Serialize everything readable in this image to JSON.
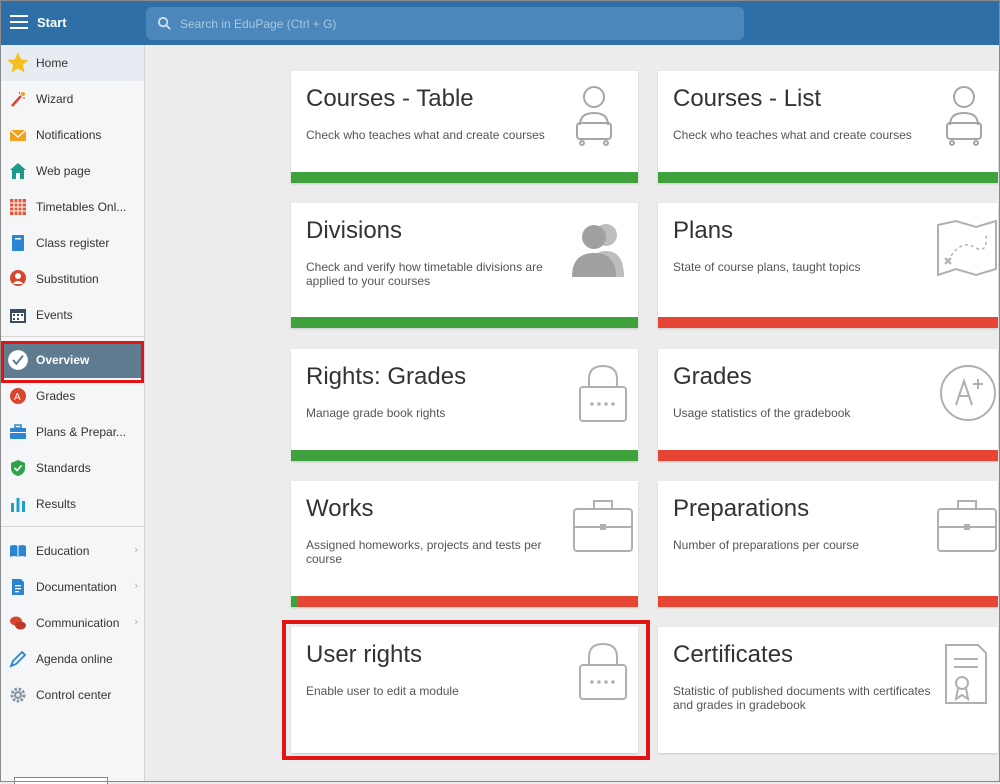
{
  "topbar": {
    "title": "Start",
    "search_placeholder": "Search in EduPage (Ctrl + G)"
  },
  "sidebar": {
    "items": [
      {
        "label": "Home",
        "icon": "star-icon"
      },
      {
        "label": "Wizard",
        "icon": "wand-icon"
      },
      {
        "label": "Notifications",
        "icon": "envelope-icon"
      },
      {
        "label": "Web page",
        "icon": "house-icon"
      },
      {
        "label": "Timetables Onl...",
        "icon": "timetable-grid-icon"
      },
      {
        "label": "Class register",
        "icon": "book-icon"
      },
      {
        "label": "Substitution",
        "icon": "substitute-person-icon"
      },
      {
        "label": "Events",
        "icon": "calendar-icon"
      },
      {
        "label": "Overview",
        "icon": "check-badge-icon"
      },
      {
        "label": "Grades",
        "icon": "grade-icon"
      },
      {
        "label": "Plans & Prepar...",
        "icon": "briefcase-icon"
      },
      {
        "label": "Standards",
        "icon": "shield-check-icon"
      },
      {
        "label": "Results",
        "icon": "bar-chart-icon"
      },
      {
        "label": "Education",
        "icon": "open-book-icon"
      },
      {
        "label": "Documentation",
        "icon": "document-icon"
      },
      {
        "label": "Communication",
        "icon": "chat-icon"
      },
      {
        "label": "Agenda online",
        "icon": "pen-icon"
      },
      {
        "label": "Control center",
        "icon": "gear-icon"
      }
    ]
  },
  "cards": [
    {
      "title": "Courses - Table",
      "desc": "Check who teaches what and create courses",
      "icon": "teacher-desk-icon",
      "status_green_fraction": 1.0
    },
    {
      "title": "Courses - List",
      "desc": "Check who teaches what and create courses",
      "icon": "teacher-desk-icon",
      "status_green_fraction": 1.0
    },
    {
      "title": "Divisions",
      "desc": "Check and verify how timetable divisions are applied to your courses",
      "icon": "people-icon",
      "status_green_fraction": 1.0
    },
    {
      "title": "Plans",
      "desc": "State of course plans, taught topics",
      "icon": "treasure-map-icon",
      "status_green_fraction": 0.0
    },
    {
      "title": "Rights: Grades",
      "desc": "Manage grade book rights",
      "icon": "padlock-icon",
      "status_green_fraction": 1.0
    },
    {
      "title": "Grades",
      "desc": "Usage statistics of the gradebook",
      "icon": "a-plus-grade-icon",
      "status_green_fraction": 0.0
    },
    {
      "title": "Works",
      "desc": "Assigned homeworks, projects and tests per course",
      "icon": "briefcase-icon",
      "status_green_fraction": 0.02
    },
    {
      "title": "Preparations",
      "desc": "Number of preparations per course",
      "icon": "briefcase-icon",
      "status_green_fraction": 0.0
    },
    {
      "title": "User rights",
      "desc": "Enable user to edit a module",
      "icon": "padlock-icon",
      "status_green_fraction": null
    },
    {
      "title": "Certificates",
      "desc": "Statistic of published documents with certificates and grades in gradebook",
      "icon": "certificate-icon",
      "status_green_fraction": null
    }
  ]
}
